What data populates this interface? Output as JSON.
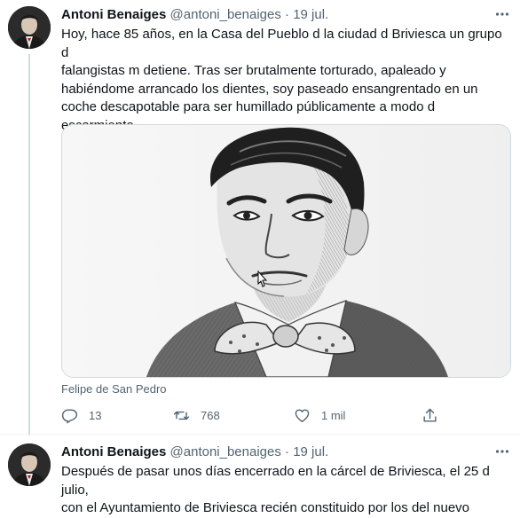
{
  "tweets": [
    {
      "author": {
        "name": "Antoni Benaiges",
        "handle": "@antoni_benaiges",
        "separator": "·",
        "date": "19 jul."
      },
      "text": "Hoy, hace 85 años, en la Casa del Pueblo d la ciudad d Briviesca un grupo d falangistas m detiene. Tras ser brutalmente torturado, apaleado y habiéndome arrancado los dientes, soy paseado ensangrentado en un coche descapotable para ser humillado públicamente a modo d escarmiento.",
      "text_lines": [
        "Hoy, hace 85 años, en la Casa del Pueblo d la ciudad d Briviesca un grupo d",
        "falangistas m detiene. Tras ser brutalmente torturado, apaleado y",
        "habiéndome arrancado los dientes, soy paseado ensangrentado en un",
        "coche descapotable para ser humillado públicamente a modo d",
        "escarmiento."
      ],
      "media": {
        "kind": "pencil-sketch-portrait",
        "caption": "Felipe de San Pedro"
      },
      "actions": {
        "reply_count": "13",
        "retweet_count": "768",
        "like_count": "1 mil"
      },
      "icons": {
        "reply": "reply-icon",
        "retweet": "retweet-icon",
        "like": "like-icon",
        "share": "share-icon",
        "more": "more-icon"
      }
    },
    {
      "author": {
        "name": "Antoni Benaiges",
        "handle": "@antoni_benaiges",
        "separator": "·",
        "date": "19 jul."
      },
      "text_lines": [
        "Después de pasar unos días encerrado en la cárcel de Briviesca, el 25 d julio,",
        "con el Ayuntamiento de Briviesca recién constituido por los del nuevo"
      ]
    }
  ],
  "colors": {
    "text": "#0f1419",
    "secondary": "#536471",
    "border": "#cfd9de",
    "thread": "#cfd9de"
  }
}
